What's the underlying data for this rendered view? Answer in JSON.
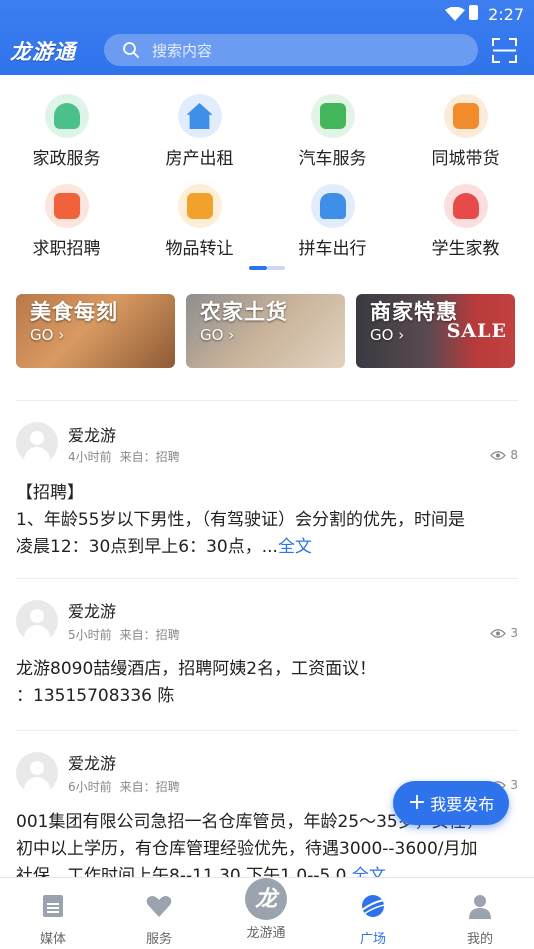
{
  "status_bar": {
    "time": "2:27"
  },
  "header": {
    "logo": "龙游通",
    "search_placeholder": "搜索内容"
  },
  "categories": [
    {
      "label": "家政服务",
      "icon": "housekeeping-icon",
      "color": "#4cc08a"
    },
    {
      "label": "房产出租",
      "icon": "house-rent-icon",
      "color": "#3f8fe8"
    },
    {
      "label": "汽车服务",
      "icon": "car-service-icon",
      "color": "#43b55a"
    },
    {
      "label": "同城带货",
      "icon": "package-icon",
      "color": "#f28b2c"
    },
    {
      "label": "求职招聘",
      "icon": "briefcase-icon",
      "color": "#f0623c"
    },
    {
      "label": "物品转让",
      "icon": "transfer-icon",
      "color": "#f2a12c"
    },
    {
      "label": "拼车出行",
      "icon": "carpool-icon",
      "color": "#3f8fe8"
    },
    {
      "label": "学生家教",
      "icon": "tutor-icon",
      "color": "#e84a4a"
    }
  ],
  "banners": [
    {
      "title": "美食每刻",
      "go": "GO"
    },
    {
      "title": "农家土货",
      "go": "GO"
    },
    {
      "title": "商家特惠",
      "go": "GO",
      "sale": "SALE"
    }
  ],
  "posts": [
    {
      "user": "爱龙游",
      "time": "4小时前",
      "source": "来自：招聘",
      "views": "8",
      "lines": [
        "【招聘】",
        "1、年龄55岁以下男性，（有驾驶证）会分割的优先，时间是",
        "凌晨12：30点到早上6：30点，..."
      ],
      "more": "全文"
    },
    {
      "user": "爱龙游",
      "time": "5小时前",
      "source": "来自：招聘",
      "views": "3",
      "lines": [
        "龙游8090喆缦酒店，招聘阿姨2名，工资面议！",
        "：13515708336 陈"
      ]
    },
    {
      "user": "爱龙游",
      "time": "6小时前",
      "source": "来自：招聘",
      "views": "3",
      "lines": [
        "001集团有限公司急招一名仓库管员，年龄25～35岁，女性，",
        "初中以上学历，有仓库管理经验优先，待遇3000--3600/月加",
        "社保。工作时间上午8--11.30 下午1.0--5.0"
      ],
      "more": "全文"
    }
  ],
  "fab": {
    "label": "我要发布"
  },
  "tabs": [
    {
      "label": "媒体",
      "icon": "news-icon"
    },
    {
      "label": "服务",
      "icon": "heart-icon"
    },
    {
      "label": "龙游通",
      "icon": "dragon-logo-icon",
      "glyph": "龙"
    },
    {
      "label": "广场",
      "icon": "planet-icon",
      "active": true
    },
    {
      "label": "我的",
      "icon": "person-icon"
    }
  ]
}
